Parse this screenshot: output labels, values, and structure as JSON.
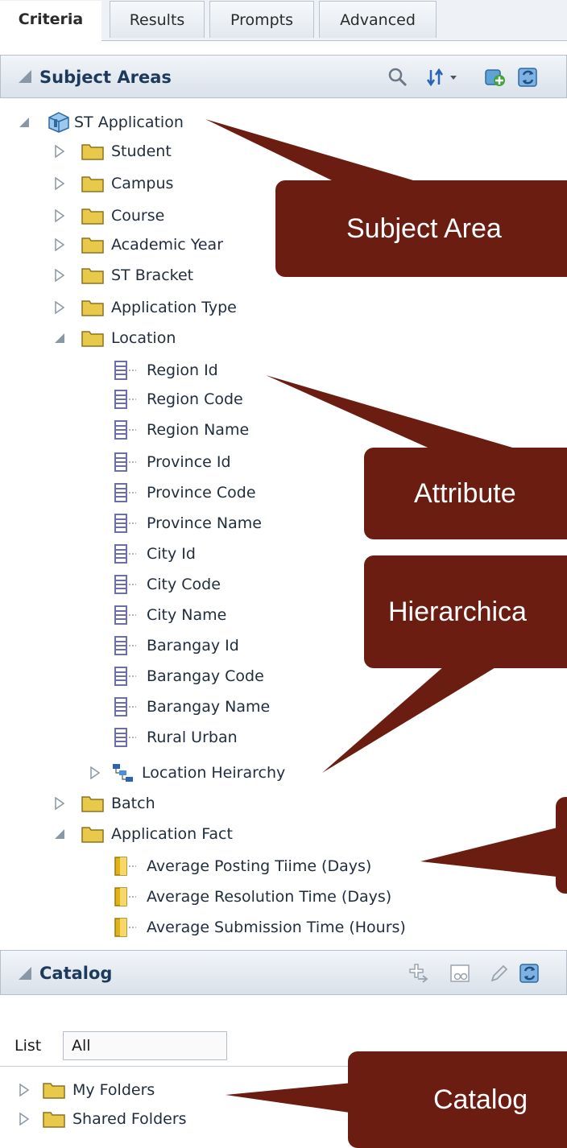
{
  "tabs": [
    {
      "label": "Criteria",
      "active": true
    },
    {
      "label": "Results",
      "active": false
    },
    {
      "label": "Prompts",
      "active": false
    },
    {
      "label": "Advanced",
      "active": false
    }
  ],
  "subject_areas": {
    "title": "Subject Areas",
    "tree": {
      "root": "ST Application",
      "folders_top": [
        "Student",
        "Campus",
        "Course",
        "Academic Year",
        "ST Bracket",
        "Application Type"
      ],
      "location": {
        "label": "Location",
        "attributes": [
          "Region Id",
          "Region Code",
          "Region Name",
          "Province Id",
          "Province Code",
          "Province Name",
          "City Id",
          "City Code",
          "City Name",
          "Barangay Id",
          "Barangay Code",
          "Barangay Name",
          "Rural Urban"
        ],
        "hierarchy": "Location Heirarchy"
      },
      "batch": "Batch",
      "application_fact": {
        "label": "Application Fact",
        "measures": [
          "Average Posting Tiime (Days)",
          "Average Resolution Time (Days)",
          "Average Submission Time (Hours)"
        ]
      }
    }
  },
  "catalog": {
    "title": "Catalog",
    "list_label": "List",
    "list_value": "All",
    "folders": [
      "My Folders",
      "Shared Folders"
    ]
  },
  "callouts": {
    "subject_area": "Subject Area",
    "attribute": "Attribute",
    "hierarchical": "Hierarchica",
    "catalog": "Catalog"
  },
  "colors": {
    "callout": "#6b1d12",
    "folder": "#e8c94a",
    "attribute_icon": "#6a6fa8",
    "measure_icon": "#e2b319"
  }
}
